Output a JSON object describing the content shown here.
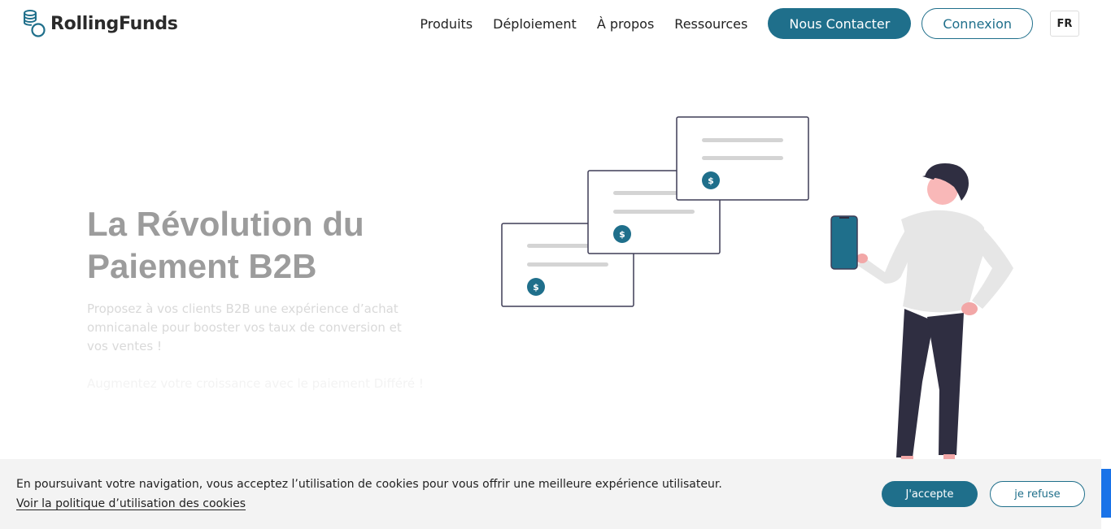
{
  "brand": {
    "name": "RollingFunds",
    "primary_color": "#1f6f8b"
  },
  "nav": {
    "links": [
      "Produits",
      "Déploiement",
      "À propos",
      "Ressources"
    ],
    "contact_label": "Nous Contacter",
    "login_label": "Connexion",
    "language": "FR"
  },
  "hero": {
    "title_line1": "La Révolution du",
    "title_line2": "Paiement B2B",
    "subtitle": "Proposez à vos clients B2B une expérience d’achat omnicanale pour booster vos taux de conversion et vos ventes !",
    "tagline": "Augmentez votre croissance avec le paiement Différé !"
  },
  "illustration": {
    "invoice_icon": "dollar-coin-icon",
    "currency_symbol": "$",
    "person": "person-with-phone"
  },
  "cookie_banner": {
    "text": "En poursuivant votre navigation, vous acceptez l’utilisation de cookies pour vous offrir une meilleure expérience utilisateur.",
    "policy_link": "Voir la politique d’utilisation des cookies",
    "accept_label": "J'accepte",
    "refuse_label": "je refuse"
  }
}
